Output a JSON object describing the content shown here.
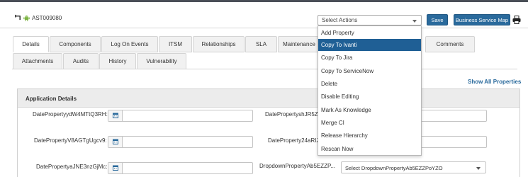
{
  "header": {
    "asset_id": "AST009080"
  },
  "actions": {
    "select_label": "Select Actions",
    "save_label": "Save",
    "bsm_label": "Business Service Map",
    "menu_items": [
      "Add Property",
      "Copy To Ivanti",
      "Copy To Jira",
      "Copy To ServiceNow",
      "Delete",
      "Disable Editing",
      "Mark As Knowledge",
      "Merge CI",
      "Release Hierarchy",
      "Rescan Now"
    ],
    "highlighted_item": "Copy To Ivanti"
  },
  "tabs": {
    "row1": [
      "Details",
      "Components",
      "Log On Events",
      "ITSM",
      "Relationships",
      "SLA",
      "Maintenance",
      "Comments"
    ],
    "row2": [
      "Attachments",
      "Audits",
      "History",
      "Vulnerability"
    ],
    "active": "Details"
  },
  "show_all_label": "Show All Properties",
  "panel": {
    "title": "Application Details",
    "fields": {
      "f1_label": "DatePropertyydW4MTtQ3RH:",
      "f2_label": "DatePropertyshJR5ZC",
      "f3_label": "DatePropertyV8AGTgUgcv9:",
      "f4_label": "DateProperty24aRIZ",
      "f5_label": "DatePropertyaJNE3nzGjMc:",
      "f6_label": "DropdownPropertyAb5EZZP...",
      "f6_value": "Select DropdownPropertyAb5EZZPoYZO"
    }
  },
  "colors": {
    "primary": "#2a6a9c",
    "menu_highlight": "#1f5f95",
    "top_bar": "#4a4f57"
  }
}
